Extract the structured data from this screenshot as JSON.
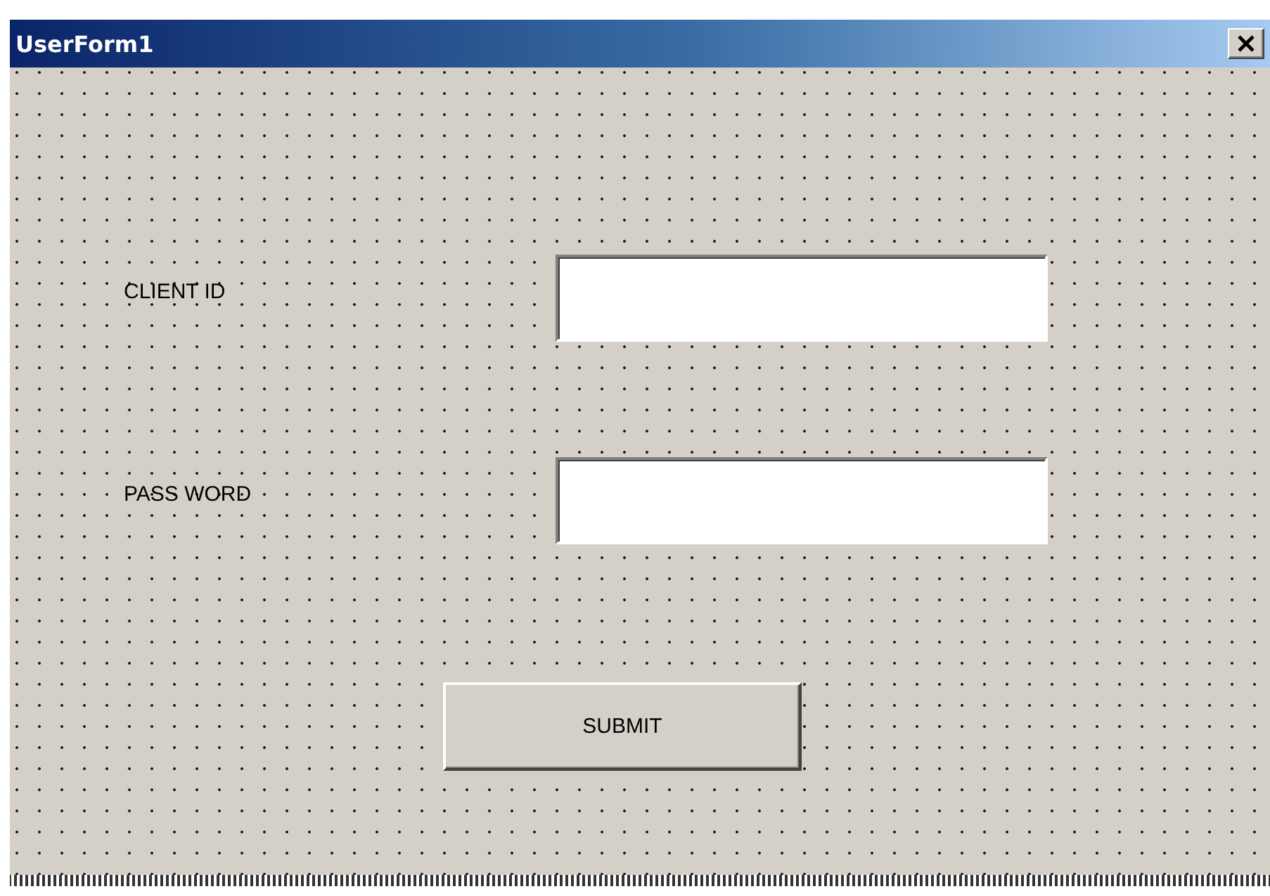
{
  "window": {
    "title": "UserForm1"
  },
  "fields": [
    {
      "label": "CLIENT ID"
    },
    {
      "label": "PASS WORD"
    }
  ],
  "buttons": [
    {
      "label": "SUBMIT"
    }
  ]
}
